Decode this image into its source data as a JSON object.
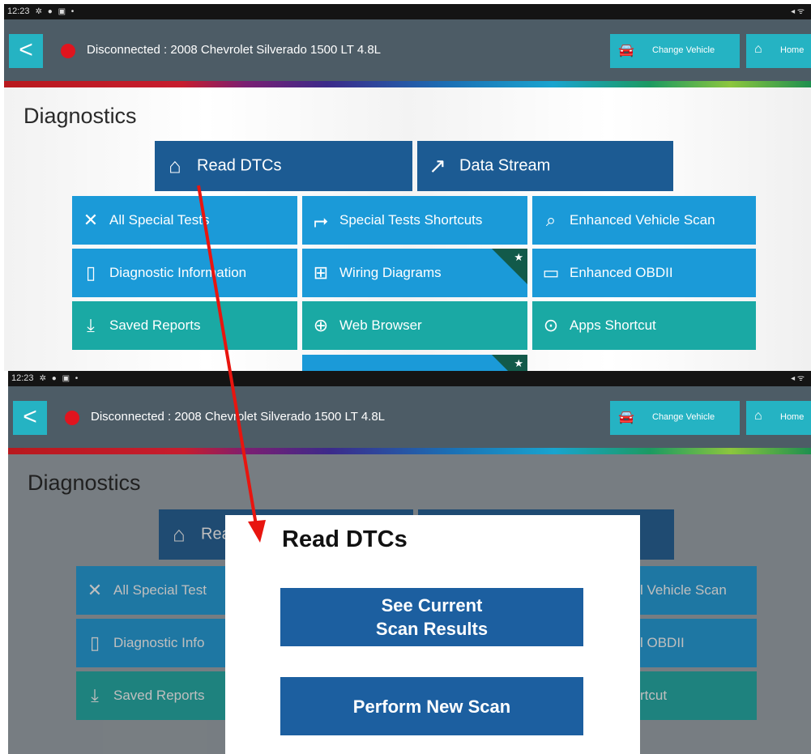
{
  "status_bar": {
    "time": "12:23",
    "icons": "✲ ● ▣ •",
    "right_icons": "◂ ᯤ"
  },
  "header": {
    "back_glyph": "<",
    "connection_text": "Disconnected : 2008 Chevrolet Silverado 1500 LT 4.8L",
    "change_vehicle_label": "Change Vehicle",
    "home_label": "Home",
    "connection_color": "#e0141e"
  },
  "diagnostics": {
    "title": "Diagnostics",
    "tiles": [
      {
        "label": "Read DTCs",
        "icon": "engine-icon"
      },
      {
        "label": "Data Stream",
        "icon": "chart-line-icon"
      },
      {
        "label": "All Special Tests",
        "icon": "tools-icon"
      },
      {
        "label": "Special Tests Shortcuts",
        "icon": "shortcut-arrow-icon"
      },
      {
        "label": "Enhanced Vehicle Scan",
        "icon": "scan-icon"
      },
      {
        "label": "Diagnostic Information",
        "icon": "book-info-icon"
      },
      {
        "label": "Wiring Diagrams",
        "icon": "wiring-icon"
      },
      {
        "label": "Enhanced OBDII",
        "icon": "obd-connector-icon"
      },
      {
        "label": "Saved Reports",
        "icon": "download-icon"
      },
      {
        "label": "Web Browser",
        "icon": "globe-icon"
      },
      {
        "label": "Apps Shortcut",
        "icon": "apps-icon"
      }
    ],
    "favorite_glyph": "★"
  },
  "overlay_view": {
    "partial_tiles": {
      "read_dtcs": "Rea",
      "all_special_tests": "All Special Test",
      "diagnostic_information": "Diagnostic Info",
      "saved_reports": "Saved Reports",
      "enhanced_vehicle_scan": "l Vehicle Scan",
      "enhanced_obdii": "l OBDII",
      "apps_shortcut": "rtcut"
    }
  },
  "modal": {
    "title": "Read DTCs",
    "see_current_line1": "See Current",
    "see_current_line2": "Scan Results",
    "perform_new_scan": "Perform New Scan"
  },
  "colors": {
    "header_bg": "#4d5c66",
    "accent_teal": "#25b3c3",
    "tile_dark_blue": "#1c5b93",
    "tile_blue": "#1b9ad8",
    "tile_teal": "#1aa9a4",
    "modal_button": "#1c5fa0",
    "annotation_arrow": "#e8150f"
  }
}
